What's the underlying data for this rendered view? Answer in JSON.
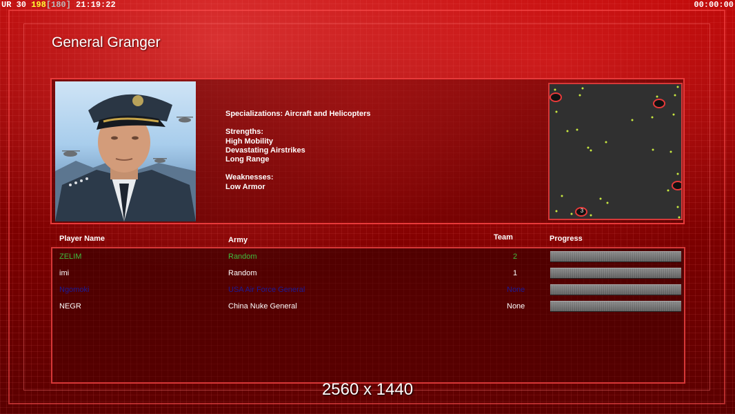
{
  "hud": {
    "ur_label": "UR",
    "ur_value": "30",
    "fps": "198",
    "fps_cap": "[180]",
    "time": "21:19:22",
    "game_timer": "00:00:00"
  },
  "general": {
    "name": "General Granger",
    "specializations": "Specializations: Aircraft and Helicopters",
    "strengths_label": "Strengths:",
    "strengths": [
      "High Mobility",
      "Devastating Airstrikes",
      "Long Range"
    ],
    "weaknesses_label": "Weaknesses:",
    "weaknesses": [
      "Low Armor"
    ]
  },
  "minimap": {
    "marker_label": "3",
    "background": "#303030",
    "border_color": "#d83838"
  },
  "players_table": {
    "headers": {
      "player": "Player Name",
      "army": "Army",
      "team": "Team",
      "progress": "Progress"
    },
    "rows": [
      {
        "name": "ZELIM",
        "army": "Random",
        "team": "2",
        "color": "#3fbf3f",
        "progress": 1.0
      },
      {
        "name": "imi",
        "army": "Random",
        "team": "1",
        "color": "#ffffff",
        "progress": 1.0
      },
      {
        "name": "Ngomoki",
        "army": "USA Air Force General",
        "team": "None",
        "color": "#1a1a9a",
        "progress": 1.0
      },
      {
        "name": "NEGR",
        "army": "China Nuke General",
        "team": "None",
        "color": "#ffffff",
        "progress": 1.0
      }
    ]
  },
  "resolution_text": "2560 x 1440",
  "colors": {
    "accent_red": "#d83838",
    "background_red": "#8a0000"
  }
}
